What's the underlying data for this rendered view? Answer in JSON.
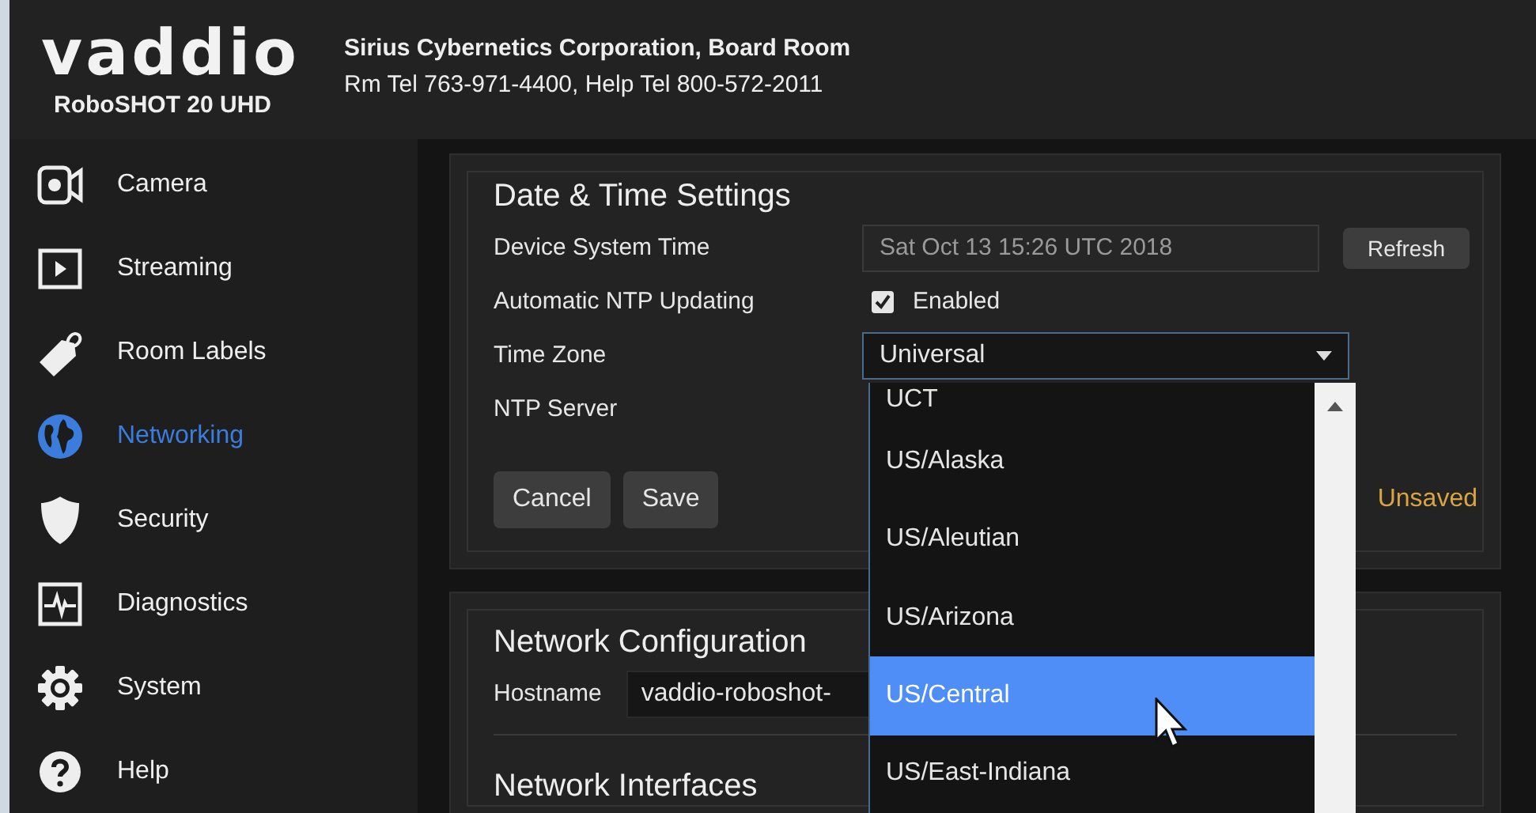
{
  "header": {
    "logo": "vaddio",
    "model": "RoboSHOT 20 UHD",
    "room": "Sirius Cybernetics Corporation, Board Room",
    "phones": "Rm Tel 763-971-4400, Help Tel 800-572-2011"
  },
  "sidebar": {
    "items": [
      {
        "kind": "camera",
        "label": "Camera",
        "selected": false
      },
      {
        "kind": "streaming",
        "label": "Streaming",
        "selected": false
      },
      {
        "kind": "tag",
        "label": "Room Labels",
        "selected": false
      },
      {
        "kind": "globe",
        "label": "Networking",
        "selected": true
      },
      {
        "kind": "shield",
        "label": "Security",
        "selected": false
      },
      {
        "kind": "pulse",
        "label": "Diagnostics",
        "selected": false
      },
      {
        "kind": "gear",
        "label": "System",
        "selected": false
      },
      {
        "kind": "help",
        "label": "Help",
        "selected": false
      }
    ]
  },
  "date_time": {
    "title": "Date & Time Settings",
    "device_time": {
      "label": "Device System Time",
      "value": "Sat Oct 13 15:26 UTC 2018",
      "button": "Refresh"
    },
    "ntp_updating": {
      "label": "Automatic NTP Updating",
      "checked": true,
      "text": "Enabled"
    },
    "time_zone": {
      "label": "Time Zone",
      "value": "Universal",
      "expanded": true,
      "options": [
        {
          "label": "UCT",
          "selected": false
        },
        {
          "label": "US/Alaska",
          "selected": false
        },
        {
          "label": "US/Aleutian",
          "selected": false
        },
        {
          "label": "US/Arizona",
          "selected": false
        },
        {
          "label": "US/Central",
          "selected": true
        },
        {
          "label": "US/East-Indiana",
          "selected": false
        }
      ]
    },
    "ntp_server": {
      "label": "NTP Server"
    },
    "buttons": [
      "Cancel",
      "Save"
    ],
    "status": "Unsaved"
  },
  "network": {
    "title": "Network Configuration",
    "hostname": {
      "label": "Hostname",
      "value": "vaddio-roboshot-"
    },
    "interfaces_title": "Network Interfaces"
  }
}
